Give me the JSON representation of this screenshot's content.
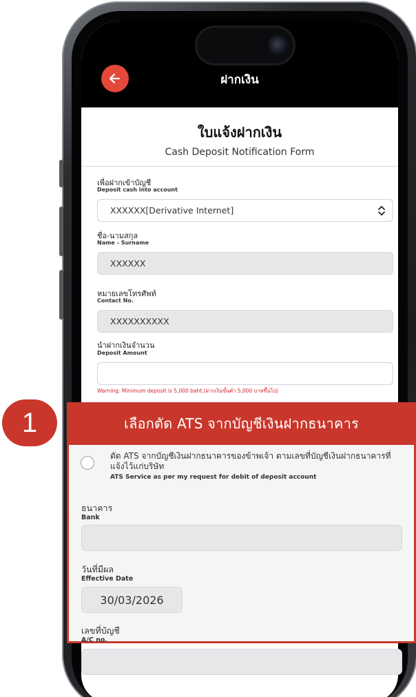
{
  "app_bar": {
    "title": "ฝากเงิน"
  },
  "form": {
    "title": "ใบแจ้งฝากเงิน",
    "subtitle": "Cash Deposit Notification Form",
    "account": {
      "label_th": "เพื่อฝากเข้าบัญชี",
      "label_en": "Deposit cash into account",
      "value_prefix": "XXXXXX",
      "value_name": "[Derivative Internet]"
    },
    "name": {
      "label_th": "ชื่อ-นามสกุล",
      "label_en": "Name - Surname",
      "value": "XXXXXX"
    },
    "phone": {
      "label_th": "หมายเลขโทรศัพท์",
      "label_en": "Contact No.",
      "value": "XXXXXXXXXX"
    },
    "amount": {
      "label_th": "นำฝากเงินจำนวน",
      "label_en": "Deposit Amount",
      "value": ""
    },
    "warning": "Warning: Minimum deposit is 5,000 baht.(ฝากเงินขั้นต่ำ 5,000 บาทขึ้นไป)"
  },
  "callout": {
    "step_number": "1",
    "banner": "เลือกตัด ATS จากบัญชีเงินฝากธนาคาร",
    "ats_option_th": "ตัด ATS จากบัญชีเงินฝากธนาคารของข้าพเจ้า ตามเลขที่บัญชีเงินฝากธนาคารที่แจ้งไว้แก่บริษัท",
    "ats_option_en": "ATS Service as per my request for debit of deposit account",
    "ats_selected": false,
    "bank": {
      "label_th": "ธนาคาร",
      "label_en": "Bank",
      "value": ""
    },
    "effective_date": {
      "label_th": "วันที่มีผล",
      "label_en": "Effective Date",
      "value": "30/03/2026"
    },
    "account_no": {
      "label_th": "เลขที่บัญชี",
      "label_en": "A/C no.",
      "value": ""
    }
  },
  "colors": {
    "accent_red": "#c9372c",
    "back_button": "#e4483a",
    "app_bar": "#000000",
    "warning_text": "#d3262a",
    "disabled_field": "#e6e7e9"
  },
  "icons": {
    "back": "arrow-left-icon",
    "select": "chevron-updown-icon"
  }
}
